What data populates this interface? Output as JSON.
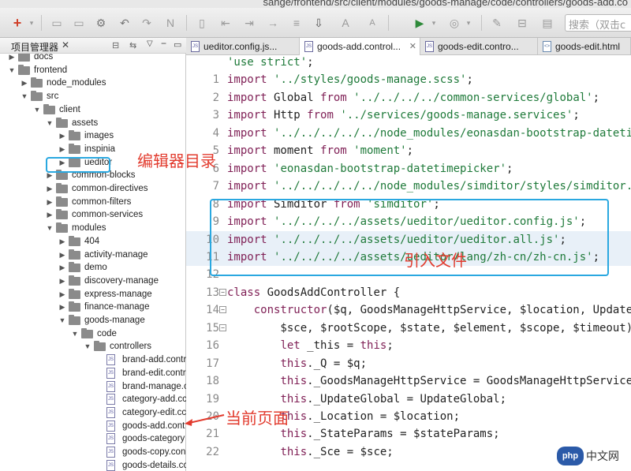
{
  "window": {
    "title": "sange/frontend/src/client/modules/goods-manage/code/controllers/goods-add.co"
  },
  "toolbar": {
    "search_placeholder": "搜索（双击c"
  },
  "left_panel": {
    "title": "项目管理器"
  },
  "tree": [
    {
      "label": "docs",
      "kind": "folder",
      "expanded": false
    },
    {
      "label": "frontend",
      "kind": "folder",
      "expanded": true
    },
    {
      "label": "node_modules",
      "kind": "folder",
      "expanded": false
    },
    {
      "label": "src",
      "kind": "folder",
      "expanded": true
    },
    {
      "label": "client",
      "kind": "folder",
      "expanded": true
    },
    {
      "label": "assets",
      "kind": "folder",
      "expanded": true
    },
    {
      "label": "images",
      "kind": "folder",
      "expanded": false
    },
    {
      "label": "inspinia",
      "kind": "folder",
      "expanded": false
    },
    {
      "label": "ueditor",
      "kind": "folder",
      "expanded": false
    },
    {
      "label": "common-blocks",
      "kind": "folder",
      "expanded": false
    },
    {
      "label": "common-directives",
      "kind": "folder",
      "expanded": false
    },
    {
      "label": "common-filters",
      "kind": "folder",
      "expanded": false
    },
    {
      "label": "common-services",
      "kind": "folder",
      "expanded": false
    },
    {
      "label": "modules",
      "kind": "folder",
      "expanded": true
    },
    {
      "label": "404",
      "kind": "folder",
      "expanded": false
    },
    {
      "label": "activity-manage",
      "kind": "folder",
      "expanded": false
    },
    {
      "label": "demo",
      "kind": "folder",
      "expanded": false
    },
    {
      "label": "discovery-manage",
      "kind": "folder",
      "expanded": false
    },
    {
      "label": "express-manage",
      "kind": "folder",
      "expanded": false
    },
    {
      "label": "finance-manage",
      "kind": "folder",
      "expanded": false
    },
    {
      "label": "goods-manage",
      "kind": "folder",
      "expanded": true
    },
    {
      "label": "code",
      "kind": "folder",
      "expanded": true
    },
    {
      "label": "controllers",
      "kind": "folder",
      "expanded": true
    },
    {
      "label": "brand-add.contr",
      "kind": "file"
    },
    {
      "label": "brand-edit.contr",
      "kind": "file"
    },
    {
      "label": "brand-manage.c",
      "kind": "file"
    },
    {
      "label": "category-add.cc",
      "kind": "file"
    },
    {
      "label": "category-edit.cc",
      "kind": "file"
    },
    {
      "label": "goods-add.cont",
      "kind": "file"
    },
    {
      "label": "goods-category",
      "kind": "file"
    },
    {
      "label": "goods-copy.con",
      "kind": "file"
    },
    {
      "label": "goods-details.cc",
      "kind": "file"
    }
  ],
  "tabs": [
    {
      "label": "ueditor.config.js..."
    },
    {
      "label": "goods-add.control..."
    },
    {
      "label": "goods-edit.contro..."
    },
    {
      "label": "goods-edit.html"
    }
  ],
  "code_lines": [
    {
      "n": "",
      "text": "'use strict';"
    },
    {
      "n": "1",
      "text": "import '../styles/goods-manage.scss';"
    },
    {
      "n": "2",
      "text": "import Global from '../../../../common-services/global';"
    },
    {
      "n": "3",
      "text": "import Http from '../services/goods-manage.services';"
    },
    {
      "n": "4",
      "text": "import '../../../../../node_modules/eonasdan-bootstrap-datetim"
    },
    {
      "n": "5",
      "text": "import moment from 'moment';"
    },
    {
      "n": "6",
      "text": "import 'eonasdan-bootstrap-datetimepicker';"
    },
    {
      "n": "7",
      "text": "import '../../../../../node_modules/simditor/styles/simditor."
    },
    {
      "n": "8",
      "text": "import Simditor from 'simditor';"
    },
    {
      "n": "9",
      "text": "import '../../../../assets/ueditor/ueditor.config.js';"
    },
    {
      "n": "10",
      "text": "import '../../../../assets/ueditor/ueditor.all.js';"
    },
    {
      "n": "11",
      "text": "import '../../../../assets/ueditor/lang/zh-cn/zh-cn.js';"
    },
    {
      "n": "12",
      "text": ""
    },
    {
      "n": "13",
      "text": "class GoodsAddController {"
    },
    {
      "n": "14",
      "text": "    constructor($q, GoodsManageHttpService, $location, UpdateGlo"
    },
    {
      "n": "15",
      "text": "        $sce, $rootScope, $state, $element, $scope, $timeout) {"
    },
    {
      "n": "16",
      "text": "        let _this = this;"
    },
    {
      "n": "17",
      "text": "        this._Q = $q;"
    },
    {
      "n": "18",
      "text": "        this._GoodsManageHttpService = GoodsManageHttpService;"
    },
    {
      "n": "19",
      "text": "        this._UpdateGlobal = UpdateGlobal;"
    },
    {
      "n": "20",
      "text": "        this._Location = $location;"
    },
    {
      "n": "21",
      "text": "        this._StateParams = $stateParams;"
    },
    {
      "n": "22",
      "text": "        this._Sce = $sce;"
    }
  ],
  "annotations": {
    "editor_dir": "编辑器目录",
    "import_files": "引入文件",
    "current_page": "当前页面"
  },
  "watermark": {
    "logo": "php",
    "text": "中文网"
  },
  "colors": {
    "annotation_red": "#e23b2e",
    "annotation_blue": "#2aa8e0",
    "keyword": "#7f1f55",
    "string": "#1f7a3a"
  }
}
